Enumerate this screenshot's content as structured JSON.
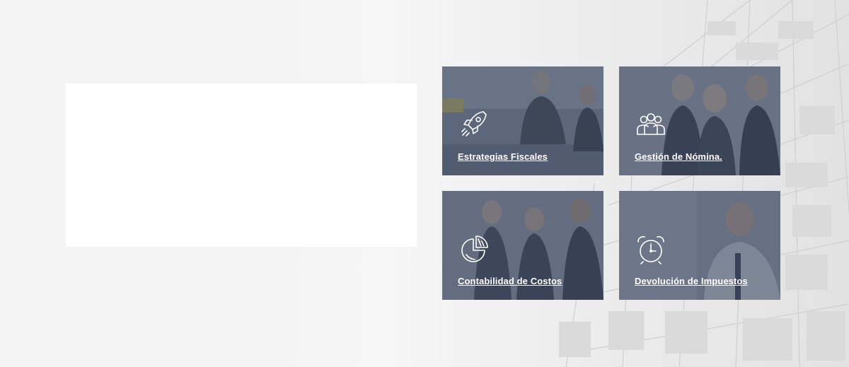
{
  "services": [
    {
      "label": "Estrategias Fiscales",
      "icon": "rocket-icon"
    },
    {
      "label": "Gestión de Nómina.",
      "icon": "team-icon"
    },
    {
      "label": "Contabilidad de Costos",
      "icon": "pie-chart-icon"
    },
    {
      "label": "Devolución de Impuestos",
      "icon": "alarm-clock-icon"
    }
  ],
  "colors": {
    "background": "#f2f2f2",
    "card_overlay": "#404c62",
    "card_text": "#ffffff"
  }
}
